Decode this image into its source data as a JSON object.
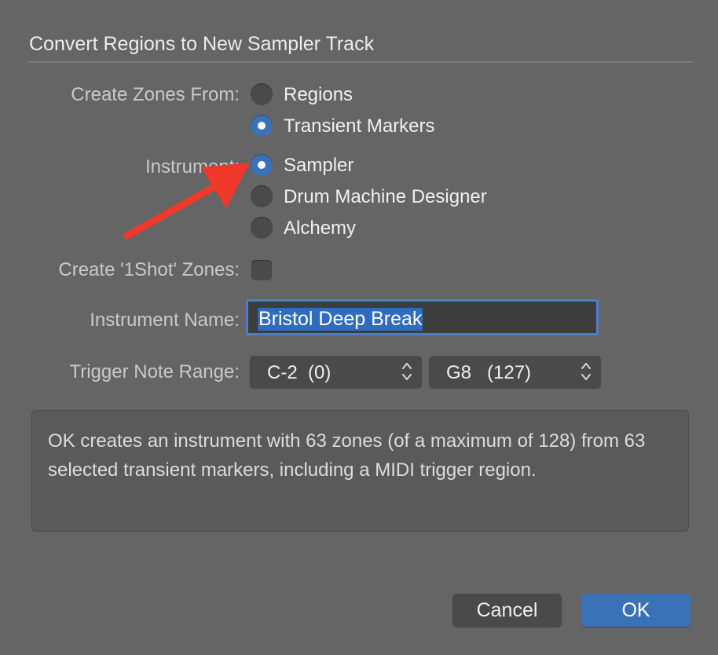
{
  "dialog": {
    "title": "Convert Regions to New Sampler Track"
  },
  "create_zones_from": {
    "label": "Create Zones From:",
    "options": [
      {
        "label": "Regions",
        "selected": false
      },
      {
        "label": "Transient Markers",
        "selected": true
      }
    ]
  },
  "instrument": {
    "label": "Instrument:",
    "options": [
      {
        "label": "Sampler",
        "selected": true
      },
      {
        "label": "Drum Machine Designer",
        "selected": false
      },
      {
        "label": "Alchemy",
        "selected": false
      }
    ]
  },
  "one_shot": {
    "label": "Create '1Shot' Zones:",
    "checked": false
  },
  "instrument_name": {
    "label": "Instrument Name:",
    "value": "Bristol Deep Break"
  },
  "trigger_note_range": {
    "label": "Trigger Note Range:",
    "low": "C-2  (0)",
    "high": "G8   (127)"
  },
  "info_text": "OK creates an instrument with 63 zones (of a maximum of 128) from 63 selected transient markers, including a MIDI trigger region.",
  "buttons": {
    "cancel": "Cancel",
    "ok": "OK"
  },
  "colors": {
    "background": "#656565",
    "accent": "#3a72b8",
    "annotation_arrow": "#f0392b"
  },
  "icons": {
    "annotation": "red-arrow-icon",
    "popup": "up-down-chevron-icon"
  }
}
